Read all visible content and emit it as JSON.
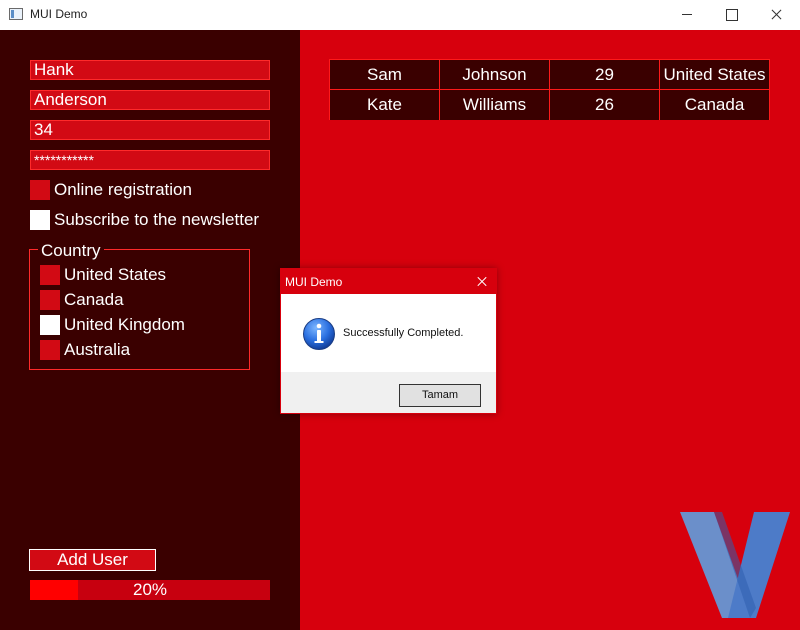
{
  "window": {
    "title": "MUI Demo"
  },
  "form": {
    "first_name": "Hank",
    "last_name": "Anderson",
    "age": "34",
    "password": "***********",
    "online_registration_label": "Online registration",
    "online_registration_checked": true,
    "newsletter_label": "Subscribe to the newsletter",
    "newsletter_checked": false,
    "add_user_label": "Add User"
  },
  "country_group": {
    "title": "Country",
    "items": [
      {
        "label": "United States",
        "selected": false
      },
      {
        "label": "Canada",
        "selected": false
      },
      {
        "label": "United Kingdom",
        "selected": true
      },
      {
        "label": "Australia",
        "selected": false
      }
    ]
  },
  "progress": {
    "value": 0.2,
    "text": "20%"
  },
  "users_table": {
    "rows": [
      [
        "Sam",
        "Johnson",
        "29",
        "United States"
      ],
      [
        "Kate",
        "Williams",
        "26",
        "Canada"
      ]
    ]
  },
  "dialog": {
    "title": "MUI Demo",
    "message": "Successfully Completed.",
    "button_label": "Tamam",
    "icon": "info-icon"
  },
  "colors": {
    "left_panel": "#3a0000",
    "right_panel": "#d7000d",
    "field": "#d20a14",
    "accent_border": "#ff2a2a",
    "progress_fill": "#ff0000"
  }
}
